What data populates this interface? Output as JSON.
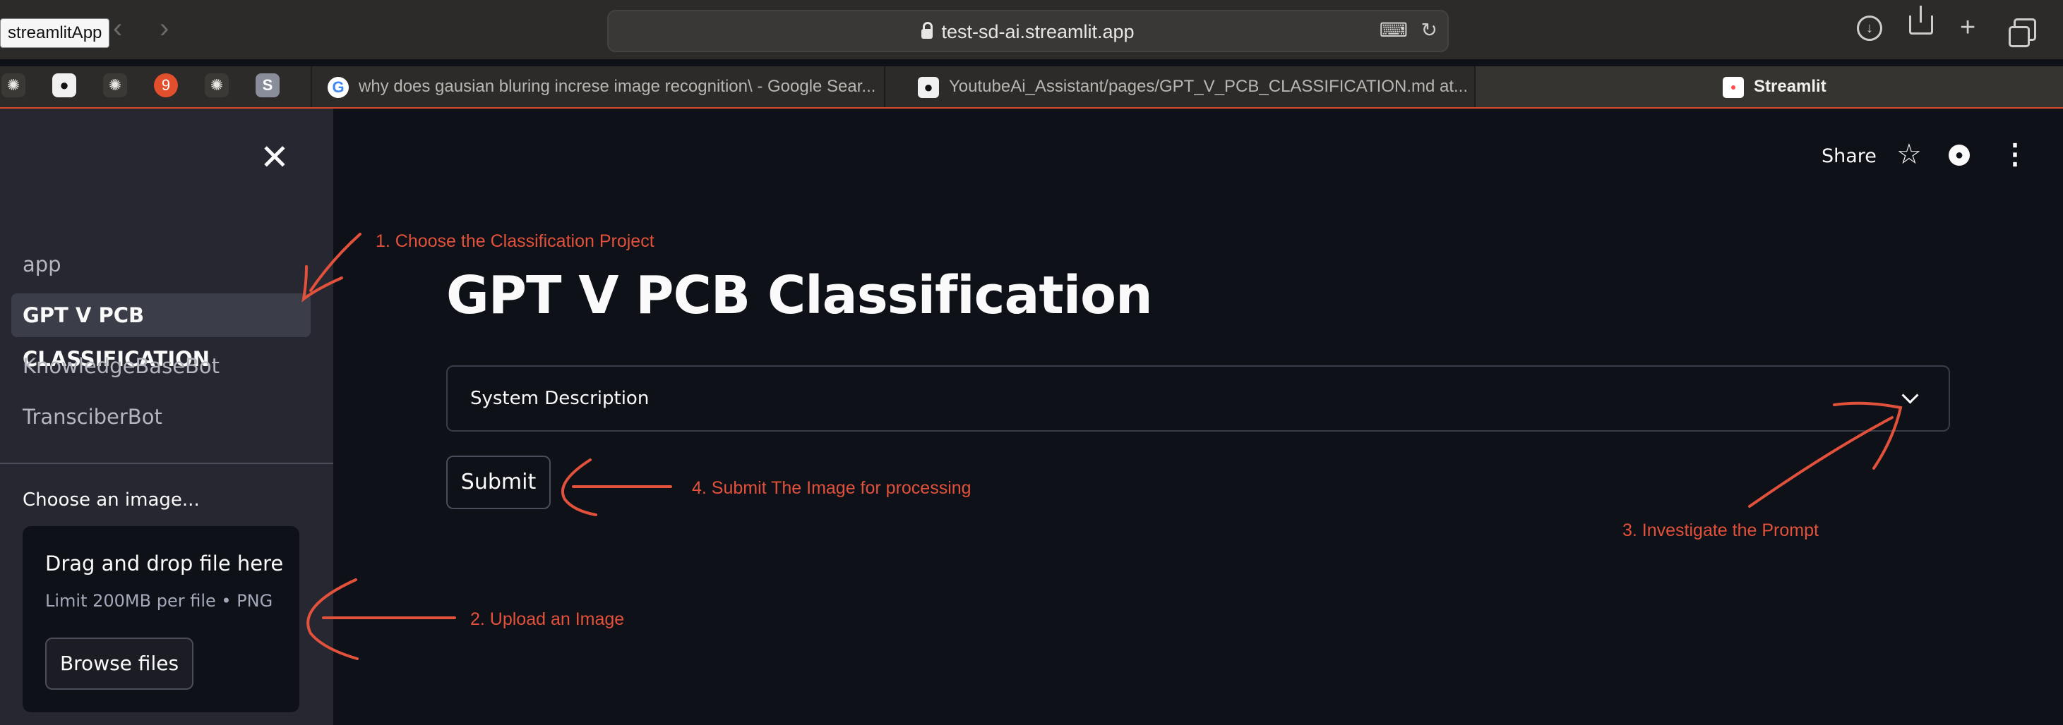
{
  "browser": {
    "app_badge": "streamlitApp",
    "url": "test-sd-ai.streamlit.app",
    "pinned_tabs": [
      {
        "icon": "chatgpt-icon",
        "glyph": "✺"
      },
      {
        "icon": "github-icon",
        "glyph": "●"
      },
      {
        "icon": "chatgpt-icon",
        "glyph": "✺"
      },
      {
        "icon": "badge-9-icon",
        "glyph": "9"
      },
      {
        "icon": "chatgpt-icon",
        "glyph": "✺"
      },
      {
        "icon": "s-icon",
        "glyph": "S"
      }
    ],
    "tabs": [
      {
        "label": "why does gausian bluring increse image recognition\\ - Google Sear...",
        "icon": "google-icon"
      },
      {
        "label": "YoutubeAi_Assistant/pages/GPT_V_PCB_CLASSIFICATION.md at...",
        "icon": "github-icon"
      },
      {
        "label": "Streamlit",
        "icon": "streamlit-icon"
      }
    ]
  },
  "sidebar": {
    "nav_items": [
      {
        "label": "app"
      },
      {
        "label": "GPT V PCB CLASSIFICATION"
      },
      {
        "label": "KnowledgeBaseBot"
      },
      {
        "label": "TransciberBot"
      }
    ],
    "uploader": {
      "label": "Choose an image...",
      "title": "Drag and drop file here",
      "subtitle": "Limit 200MB per file • PNG",
      "button": "Browse files"
    }
  },
  "header": {
    "share_label": "Share"
  },
  "main": {
    "title": "GPT V PCB Classification",
    "expander_label": "System Description",
    "submit_label": "Submit"
  },
  "annotations": {
    "step1": "1. Choose the Classification Project",
    "step2": "2. Upload an Image",
    "step3": "3. Investigate the Prompt",
    "step4": "4. Submit The Image for processing"
  },
  "colors": {
    "accent_annotation": "#e2513b",
    "background": "#0e1117",
    "sidebar": "#262730"
  }
}
